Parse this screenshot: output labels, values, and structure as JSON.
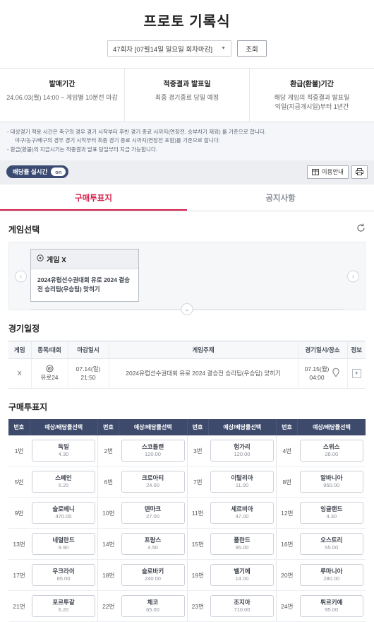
{
  "header": {
    "title": "프로토 기록식",
    "round_select_value": "47회차 [07월14일 일요일 회차마감]",
    "search_button": "조회"
  },
  "info_boxes": [
    {
      "title": "발매기간",
      "lines": [
        "24.06.03(월) 14:00 ~ 게임별 10분전 마감"
      ]
    },
    {
      "title": "적중결과 발표일",
      "lines": [
        "최종 경기종료 당일 예정"
      ]
    },
    {
      "title": "환급(환불)기간",
      "lines": [
        "해당 게임의 적중결과 발표일",
        "익일(지급개시일)부터 1년간"
      ]
    }
  ],
  "notices": [
    "- 대상경기 적용 시간은 축구의 경우 경기 시작부터 후반 경기 종료 시까지(연장전, 승부차기 제외) 를 기준으로 합니다.",
    "야구/농구/배구의 경우 경기 시작부터 최종 경기 종료 시까지(연장전 포함)를 기준으로 합니다.",
    "- 환급(환불)의 지급시기는 적중결과 발표 당일부터 지급 가능합니다."
  ],
  "toolbar": {
    "live_toggle_label": "배당률 실시간",
    "live_toggle_state": "on",
    "guide_button": "이용안내",
    "print_button": "인쇄"
  },
  "tabs": [
    {
      "label": "구매투표지",
      "active": true
    },
    {
      "label": "공지사항",
      "active": false
    }
  ],
  "game_select": {
    "section_title": "게임선택",
    "refresh_label": "새로고침",
    "card": {
      "game_code": "게임 X",
      "subject": "2024유럽선수권대회 유로 2024 결승전 승리팀(우승팀) 맞히기"
    },
    "prev_label": "이전",
    "next_label": "다음",
    "expand_label": "더보기"
  },
  "schedule": {
    "section_title": "경기일정",
    "columns": [
      "게임",
      "종목/대회",
      "마감일시",
      "게임주제",
      "경기일시/장소",
      "정보"
    ],
    "rows": [
      {
        "game": "X",
        "sport": "유로24",
        "deadline_date": "07.14(일)",
        "deadline_time": "21:50",
        "subject": "2024유럽선수권대회 유로 2024 결승전 승리팀(우승팀) 맞히기",
        "match_date": "07.15(월)",
        "match_time": "04:00",
        "info": "+"
      }
    ]
  },
  "betting": {
    "section_title": "구매투표지",
    "columns": [
      "번호",
      "예상/배당률선택"
    ],
    "options": [
      {
        "no": "1번",
        "team": "독일",
        "odds": "4.30"
      },
      {
        "no": "2번",
        "team": "스코틀랜",
        "odds": "120.00"
      },
      {
        "no": "3번",
        "team": "헝가리",
        "odds": "120.00"
      },
      {
        "no": "4번",
        "team": "스위스",
        "odds": "28.00"
      },
      {
        "no": "5번",
        "team": "스페인",
        "odds": "5.20"
      },
      {
        "no": "6번",
        "team": "크로아티",
        "odds": "24.00"
      },
      {
        "no": "7번",
        "team": "이탈리아",
        "odds": "11.00"
      },
      {
        "no": "8번",
        "team": "알바니아",
        "odds": "950.00"
      },
      {
        "no": "9번",
        "team": "슬로베니",
        "odds": "470.00"
      },
      {
        "no": "10번",
        "team": "덴마크",
        "odds": "27.00"
      },
      {
        "no": "11번",
        "team": "세르비아",
        "odds": "47.00"
      },
      {
        "no": "12번",
        "team": "잉글랜드",
        "odds": "4.30"
      },
      {
        "no": "13번",
        "team": "네덜란드",
        "odds": "9.90"
      },
      {
        "no": "14번",
        "team": "프랑스",
        "odds": "4.50"
      },
      {
        "no": "15번",
        "team": "폴란드",
        "odds": "95.00"
      },
      {
        "no": "16번",
        "team": "오스트리",
        "odds": "55.00"
      },
      {
        "no": "17번",
        "team": "우크라이",
        "odds": "65.00"
      },
      {
        "no": "18번",
        "team": "슬로바키",
        "odds": "240.00"
      },
      {
        "no": "19번",
        "team": "벨기에",
        "odds": "14.00"
      },
      {
        "no": "20번",
        "team": "루마니아",
        "odds": "280.00"
      },
      {
        "no": "21번",
        "team": "포르투갈",
        "odds": "6.20"
      },
      {
        "no": "22번",
        "team": "체코",
        "odds": "65.00"
      },
      {
        "no": "23번",
        "team": "조지아",
        "odds": "710.00"
      },
      {
        "no": "24번",
        "team": "튀르키예",
        "odds": "95.00"
      }
    ]
  },
  "colors": {
    "accent": "#d5204a",
    "header_navy": "#3d4a6b",
    "toggle_navy": "#3b4a72"
  }
}
